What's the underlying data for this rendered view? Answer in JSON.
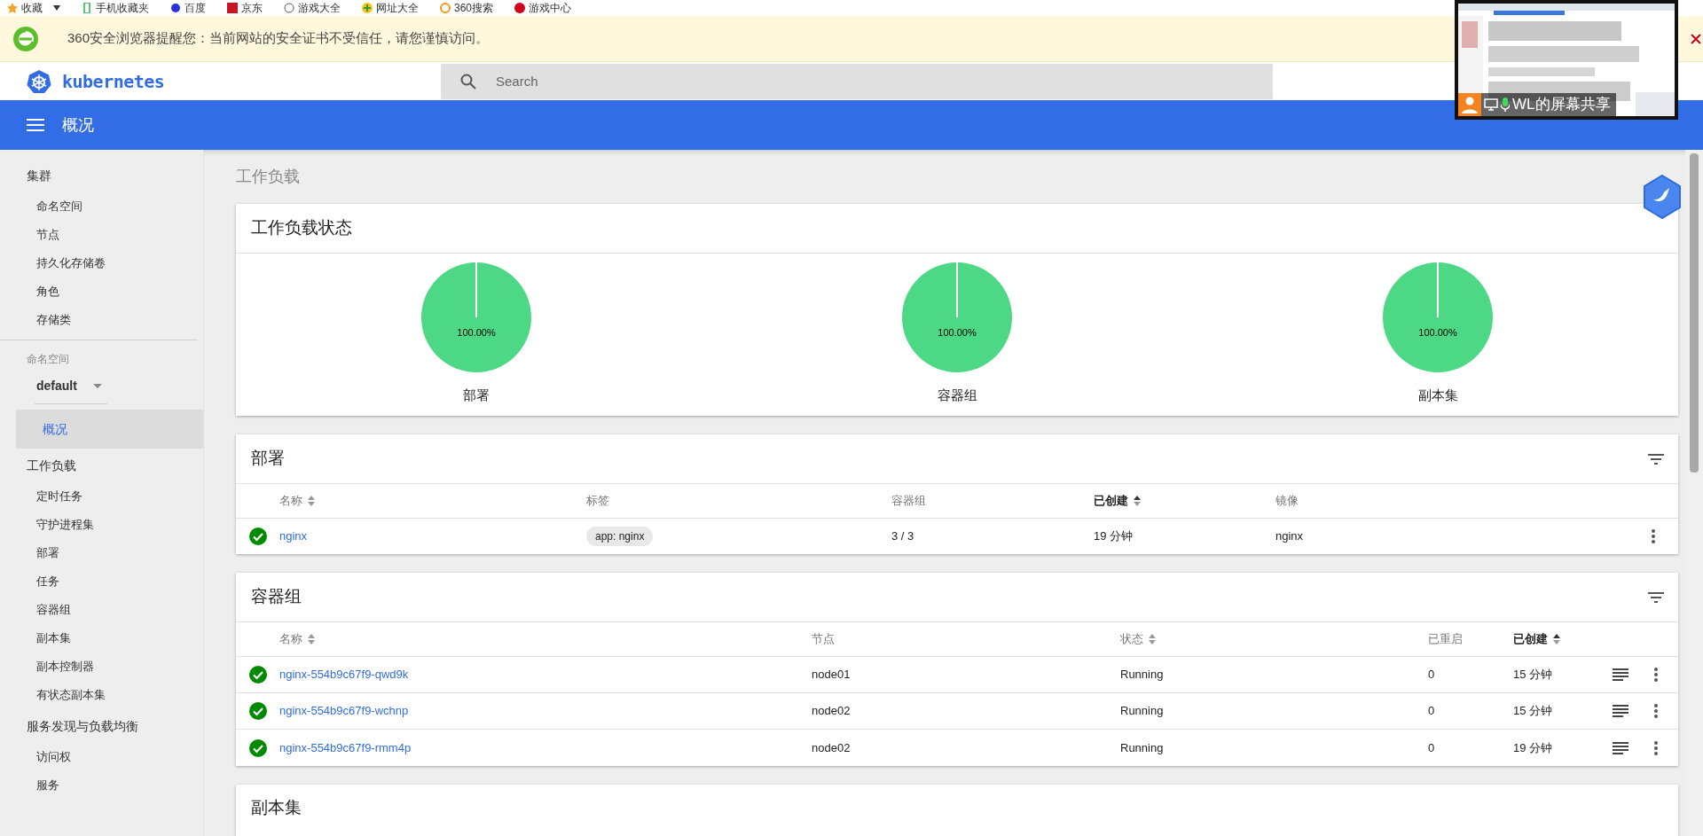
{
  "bookmarks": [
    "收藏",
    "手机收藏夹",
    "百度",
    "京东",
    "游戏大全",
    "网址大全",
    "360搜索",
    "游戏中心"
  ],
  "security_warning": {
    "text": "360安全浏览器提醒您：当前网站的安全证书不受信任，请您谨慎访问。"
  },
  "screen_share": {
    "label": "WL的屏幕共享"
  },
  "header": {
    "logo_text": "kubernetes",
    "search": {
      "placeholder": "Search"
    }
  },
  "toolbar": {
    "title": "概况"
  },
  "sidebar": {
    "cluster_items": [
      {
        "label": "集群",
        "selected": false,
        "children": [
          {
            "label": "命名空间",
            "selected": false
          },
          {
            "label": "节点",
            "selected": false
          },
          {
            "label": "持久化存储卷",
            "selected": false
          },
          {
            "label": "角色",
            "selected": false
          },
          {
            "label": "存储类",
            "selected": false
          }
        ]
      }
    ],
    "namespace": {
      "label": "命名空间",
      "value": "default"
    },
    "items": [
      {
        "label": "概况",
        "selected": true
      },
      {
        "label": "工作负载",
        "selected": false,
        "children": [
          {
            "label": "定时任务",
            "selected": false
          },
          {
            "label": "守护进程集",
            "selected": false
          },
          {
            "label": "部署",
            "selected": false
          },
          {
            "label": "任务",
            "selected": false
          },
          {
            "label": "容器组",
            "selected": false
          },
          {
            "label": "副本集",
            "selected": false
          },
          {
            "label": "副本控制器",
            "selected": false
          },
          {
            "label": "有状态副本集",
            "selected": false
          }
        ]
      },
      {
        "label": "服务发现与负载均衡",
        "selected": false,
        "children": [
          {
            "label": "访问权",
            "selected": false
          },
          {
            "label": "服务",
            "selected": false
          }
        ]
      }
    ]
  },
  "page_title": "工作负载",
  "workload_status": {
    "title": "工作负载状态",
    "charts": [
      {
        "chart_data": {
          "type": "pie",
          "title": "部署",
          "values": [
            100
          ],
          "value_labels": [
            "100.00%"
          ]
        }
      },
      {
        "chart_data": {
          "type": "pie",
          "title": "容器组",
          "values": [
            100
          ],
          "value_labels": [
            "100.00%"
          ]
        }
      },
      {
        "chart_data": {
          "type": "pie",
          "title": "副本集",
          "values": [
            100
          ],
          "value_labels": [
            "100.00%"
          ]
        }
      }
    ]
  },
  "deployments": {
    "title": "部署",
    "columns": [
      {
        "label": "名称",
        "sortable": true,
        "sorted": false
      },
      {
        "label": "标签",
        "sortable": false,
        "sorted": false
      },
      {
        "label": "容器组",
        "sortable": false,
        "sorted": false
      },
      {
        "label": "已创建",
        "sortable": true,
        "sorted": true
      },
      {
        "label": "镜像",
        "sortable": false,
        "sorted": false
      }
    ],
    "rows": [
      {
        "ok": true,
        "name": "nginx",
        "label": "app: nginx",
        "pods": "3 / 3",
        "created": "19 分钟",
        "image": "nginx"
      }
    ]
  },
  "pods": {
    "title": "容器组",
    "columns": [
      {
        "label": "名称",
        "sortable": true,
        "sorted": false
      },
      {
        "label": "节点",
        "sortable": false,
        "sorted": false
      },
      {
        "label": "状态",
        "sortable": true,
        "sorted": false
      },
      {
        "label": "已重启",
        "sortable": false,
        "sorted": false
      },
      {
        "label": "已创建",
        "sortable": true,
        "sorted": true
      }
    ],
    "rows": [
      {
        "ok": true,
        "name": "nginx-554b9c67f9-qwd9k",
        "node": "node01",
        "status": "Running",
        "restarts": "0",
        "created": "15 分钟"
      },
      {
        "ok": true,
        "name": "nginx-554b9c67f9-wchnp",
        "node": "node02",
        "status": "Running",
        "restarts": "0",
        "created": "15 分钟"
      },
      {
        "ok": true,
        "name": "nginx-554b9c67f9-rmm4p",
        "node": "node02",
        "status": "Running",
        "restarts": "0",
        "created": "19 分钟"
      }
    ]
  },
  "replica_sets": {
    "title": "副本集"
  }
}
